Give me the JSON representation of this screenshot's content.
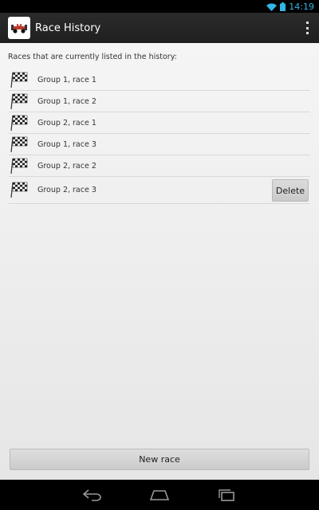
{
  "status_bar": {
    "time": "14:19",
    "icons": [
      "wifi-icon",
      "battery-icon"
    ],
    "accent_color": "#33b5e5"
  },
  "action_bar": {
    "title": "Race History",
    "app_icon": "race-car-icon",
    "overflow_icon": "overflow-menu-icon"
  },
  "content": {
    "intro_text": "Races that are currently listed in the history:",
    "races": [
      {
        "label": "Group 1, race 1",
        "icon": "checkered-flag-icon"
      },
      {
        "label": "Group 1, race 2",
        "icon": "checkered-flag-icon"
      },
      {
        "label": "Group 2, race 1",
        "icon": "checkered-flag-icon"
      },
      {
        "label": "Group 1, race 3",
        "icon": "checkered-flag-icon"
      },
      {
        "label": "Group 2, race 2",
        "icon": "checkered-flag-icon"
      },
      {
        "label": "Group 2, race 3",
        "icon": "checkered-flag-icon",
        "delete_label": "Delete"
      }
    ],
    "new_race_label": "New race"
  },
  "nav_bar": {
    "buttons": [
      "back-icon",
      "home-icon",
      "recent-apps-icon"
    ]
  }
}
